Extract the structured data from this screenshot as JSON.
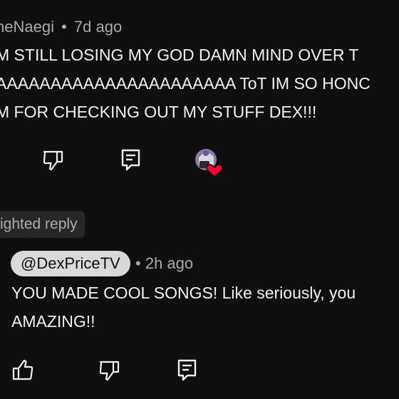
{
  "parent_comment": {
    "author": "neNaegi",
    "separator": "•",
    "time": "7d ago",
    "lines": [
      "M STILL LOSING MY GOD DAMN MIND OVER T",
      "AAAAAAAAAAAAAAAAAAAAAA ToT IM SO HONC",
      "M FOR CHECKING OUT MY STUFF DEX!!!"
    ],
    "actions": {
      "dislike_icon": "thumbs-down-icon",
      "reply_icon": "reply-comment-icon",
      "creator_heart_icon": "creator-heart-avatar-icon"
    }
  },
  "highlighted_label": "ighted reply",
  "reply": {
    "author": "@DexPriceTV",
    "separator": "•",
    "time": "2h ago",
    "lines": [
      "YOU MADE COOL SONGS! Like seriously, you",
      "AMAZING!!"
    ],
    "actions": {
      "like_icon": "thumbs-up-icon",
      "dislike_icon": "thumbs-down-icon",
      "reply_icon": "reply-comment-icon"
    }
  },
  "colors": {
    "background": "#0f0f0f",
    "text": "#f1f1f1",
    "secondary": "#aaaaaa",
    "chip": "#d9d9d9",
    "heart": "#ff0033"
  }
}
